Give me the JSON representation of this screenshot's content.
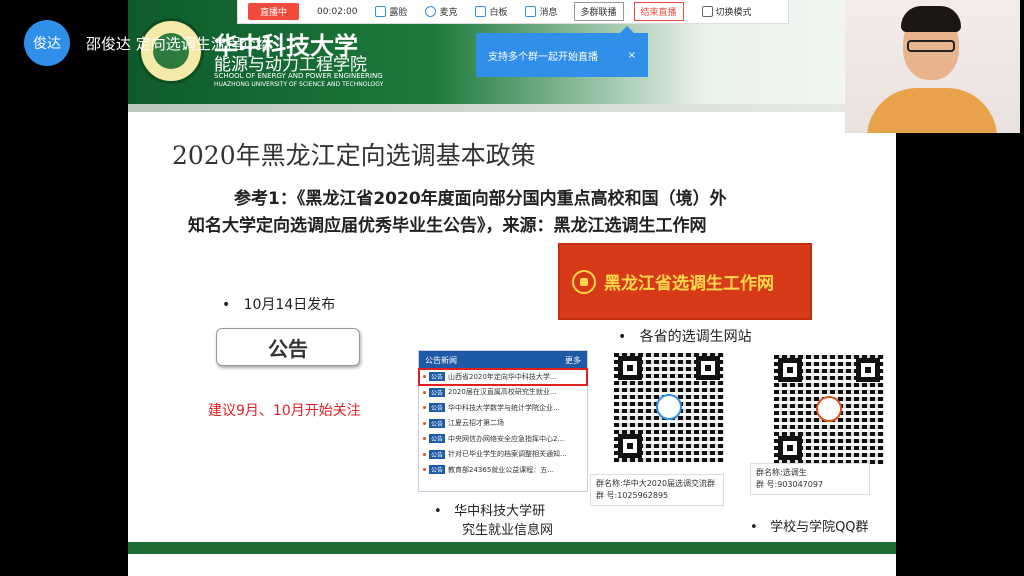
{
  "user": {
    "badge": "俊达",
    "title": "邵俊达 定向选调生流程介绍"
  },
  "toolbar": {
    "live": "直播中",
    "time": "00:02:00",
    "items": [
      "露脸",
      "麦克",
      "白板",
      "消息"
    ],
    "multi_group": "多群联播",
    "end_live": "结束直播",
    "switch_mode": "切换模式",
    "tooltip": "支持多个群一起开始直播",
    "tooltip_close": "×"
  },
  "slide": {
    "school_cn": "华中科技大学",
    "school_dept": "能源与动力工程学院",
    "school_en1": "SCHOOL OF ENERGY AND POWER ENGINEERING",
    "school_en2": "HUAZHONG UNIVERSITY OF SCIENCE AND TECHNOLOGY",
    "title": "2020年黑龙江定向选调基本政策",
    "ref_line1": "参考1：《黑龙江省2020年度面向部分国内重点高校和国（境）外",
    "ref_line2": "知名大学定向选调应届优秀毕业生公告》，来源：黑龙江选调生工作网",
    "hlj_banner": "黑龙江省选调生工作网",
    "bullet_date": "10月14日发布",
    "bullet_sites": "各省的选调生网站",
    "notice_label": "公告",
    "suggest": "建议9月、10月开始关注",
    "news": {
      "header": "公告新闻",
      "more": "更多",
      "items": [
        "山西省2020年定向华中科技大学...",
        "2020届在汉直属高校研究生就业...",
        "华中科技大学数学与统计学院企业...",
        "江夏云招才第二场",
        "中央网信办网络安全应急指挥中心2...",
        "针对已毕业学生的档案调整相关通知...",
        "教育部24365就业公益课程：五..."
      ],
      "tag": "公告"
    },
    "qq_card1": {
      "name": "群名称:华中大2020届选调交流群",
      "number": "群   号:1025962895"
    },
    "qq_card2": {
      "name": "群名称:选调生",
      "number": "群   号:903047097"
    },
    "caption_news": [
      "华中科技大学研",
      "究生就业信息网"
    ],
    "caption_qq": "学校与学院QQ群"
  },
  "colors": {
    "accent": "#2f8fe9",
    "live": "#f04b3a",
    "banner_green": "#1d7a3c",
    "hlj_red": "#d73a18"
  }
}
